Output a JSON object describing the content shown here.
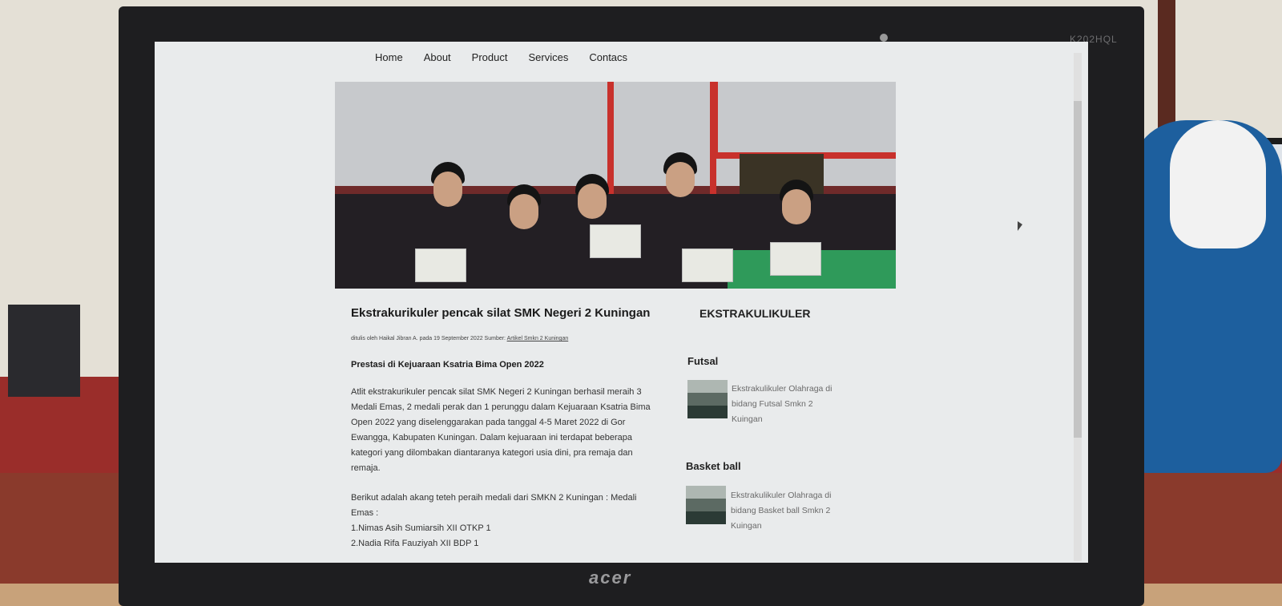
{
  "monitor": {
    "model": "K202HQL",
    "brand": "acer"
  },
  "nav": [
    "Home",
    "About",
    "Product",
    "Services",
    "Contacs"
  ],
  "article": {
    "title": "Ekstrakurikuler pencak silat SMK Negeri 2 Kuningan",
    "meta_prefix": "ditulis oleh Haikal Jibran A. pada 19 September 2022 Sumber:",
    "meta_link": "Artikel Smkn 2 Kuningan",
    "subtitle": "Prestasi di Kejuaraan Ksatria Bima Open 2022",
    "para1_lines": [
      "Atlit ekstrakurikuler pencak silat SMK Negeri 2 Kuningan berhasil meraih 3",
      "Medali Emas, 2 medali perak dan 1 perunggu dalam Kejuaraan Ksatria Bima",
      "Open 2022 yang diselenggarakan pada tanggal 4-5 Maret 2022 di Gor",
      "Ewangga, Kabupaten Kuningan. Dalam kejuaraan ini terdapat beberapa",
      "kategori yang dilombakan diantaranya kategori usia dini, pra remaja dan",
      "remaja."
    ],
    "para2_lines": [
      "Berikut adalah akang teteh peraih medali dari SMKN 2 Kuningan : Medali",
      "Emas :",
      "1.Nimas Asih Sumiarsih XII OTKP 1",
      "2.Nadia Rifa Fauziyah XII BDP 1"
    ]
  },
  "sidebar": {
    "title": "EKSTRAKULIKULER",
    "items": [
      {
        "category": "Futsal",
        "lines": [
          "Ekstrakulikuler Olahraga di",
          "bidang Futsal Smkn 2",
          "Kuingan"
        ]
      },
      {
        "category": "Basket ball",
        "lines": [
          "Ekstrakulikuler Olahraga di",
          "bidang Basket ball Smkn 2",
          "Kuingan"
        ]
      }
    ]
  }
}
